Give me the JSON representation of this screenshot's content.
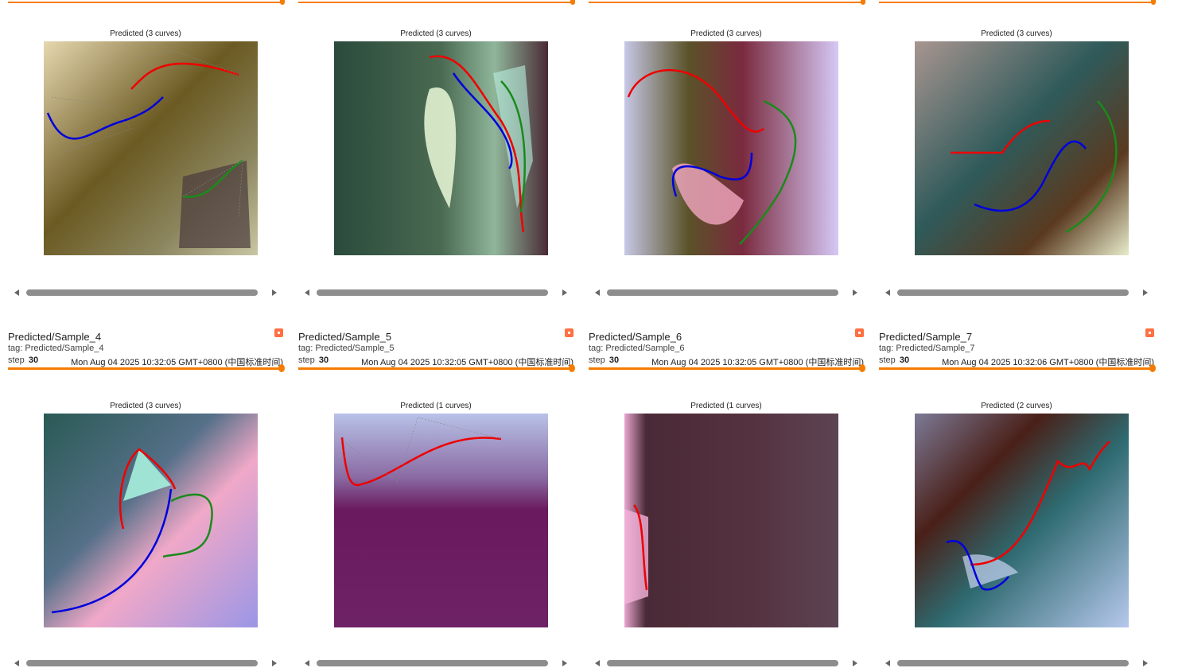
{
  "colors": {
    "accent": "#f57c00",
    "pin": "#ff7043",
    "thumb": "#8d8d8d"
  },
  "row1": [
    {
      "plot_title": "Predicted (3 curves)",
      "bg": [
        "#d9d2b0",
        "#5a4a1a",
        "#b0ad8e",
        "#3b3a3c"
      ]
    },
    {
      "plot_title": "Predicted (3 curves)",
      "bg": [
        "#2d4a3c",
        "#cde6c4",
        "#7fa98d",
        "#4a2a36"
      ]
    },
    {
      "plot_title": "Predicted (3 curves)",
      "bg": [
        "#c6c8e6",
        "#4b4a1e",
        "#f1a0b8",
        "#d3c6f4"
      ]
    },
    {
      "plot_title": "Predicted (3 curves)",
      "bg": [
        "#a08f8a",
        "#2f5a5a",
        "#e7c7d2",
        "#e6ecc8"
      ]
    }
  ],
  "row2": [
    {
      "title": "Predicted/Sample_4",
      "tag": "tag: Predicted/Sample_4",
      "step_label": "step",
      "step": "30",
      "time": "Mon Aug 04 2025 10:32:05 GMT+0800 (中国标准时间)",
      "plot_title": "Predicted (3 curves)",
      "bg": [
        "#2a5a55",
        "#a2e8d8",
        "#f5a3c8",
        "#9292e0"
      ]
    },
    {
      "title": "Predicted/Sample_5",
      "tag": "tag: Predicted/Sample_5",
      "step_label": "step",
      "step": "30",
      "time": "Mon Aug 04 2025 10:32:05 GMT+0800 (中国标准时间)",
      "plot_title": "Predicted (1 curves)",
      "bg": [
        "#b8c2e8",
        "#6a1a5e",
        "#7a2a6e",
        "#6a2060"
      ]
    },
    {
      "title": "Predicted/Sample_6",
      "tag": "tag: Predicted/Sample_6",
      "step_label": "step",
      "step": "30",
      "time": "Mon Aug 04 2025 10:32:05 GMT+0800 (中国标准时间)",
      "plot_title": "Predicted (1 curves)",
      "bg": [
        "#4a2a36",
        "#f0b0d8",
        "#5a3a48",
        "#5c4452"
      ]
    },
    {
      "title": "Predicted/Sample_7",
      "tag": "tag: Predicted/Sample_7",
      "step_label": "step",
      "step": "30",
      "time": "Mon Aug 04 2025 10:32:06 GMT+0800 (中国标准时间)",
      "plot_title": "Predicted (2 curves)",
      "bg": [
        "#7a7a95",
        "#3a1a14",
        "#2e6a70",
        "#b6c8ec"
      ]
    }
  ]
}
